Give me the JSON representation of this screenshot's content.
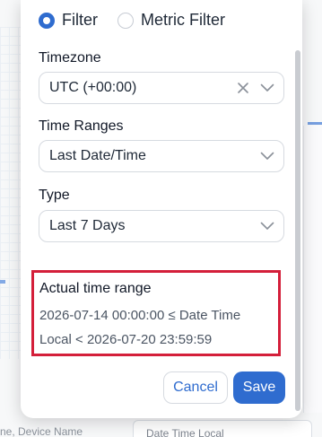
{
  "background": {
    "bottom_text": "ne, Device Name",
    "bottom_chip_label": "Date Time Local"
  },
  "popup": {
    "filter_type": {
      "options": [
        {
          "label": "Filter",
          "selected": true
        },
        {
          "label": "Metric Filter",
          "selected": false
        }
      ]
    },
    "timezone": {
      "label": "Timezone",
      "value": "UTC (+00:00)",
      "clear_icon": "close-icon",
      "dropdown_icon": "chevron-down-icon"
    },
    "time_ranges": {
      "label": "Time Ranges",
      "value": "Last Date/Time",
      "dropdown_icon": "chevron-down-icon"
    },
    "type": {
      "label": "Type",
      "value": "Last 7 Days",
      "dropdown_icon": "chevron-down-icon"
    },
    "actual_time_range": {
      "title": "Actual time range",
      "line1": "2026-07-14 00:00:00  ≤  Date Time",
      "line2": "Local  <  2026-07-20 23:59:59"
    },
    "buttons": {
      "cancel": "Cancel",
      "save": "Save"
    }
  },
  "colors": {
    "accent": "#2f6ccf",
    "highlight_border": "#d41f3a"
  }
}
